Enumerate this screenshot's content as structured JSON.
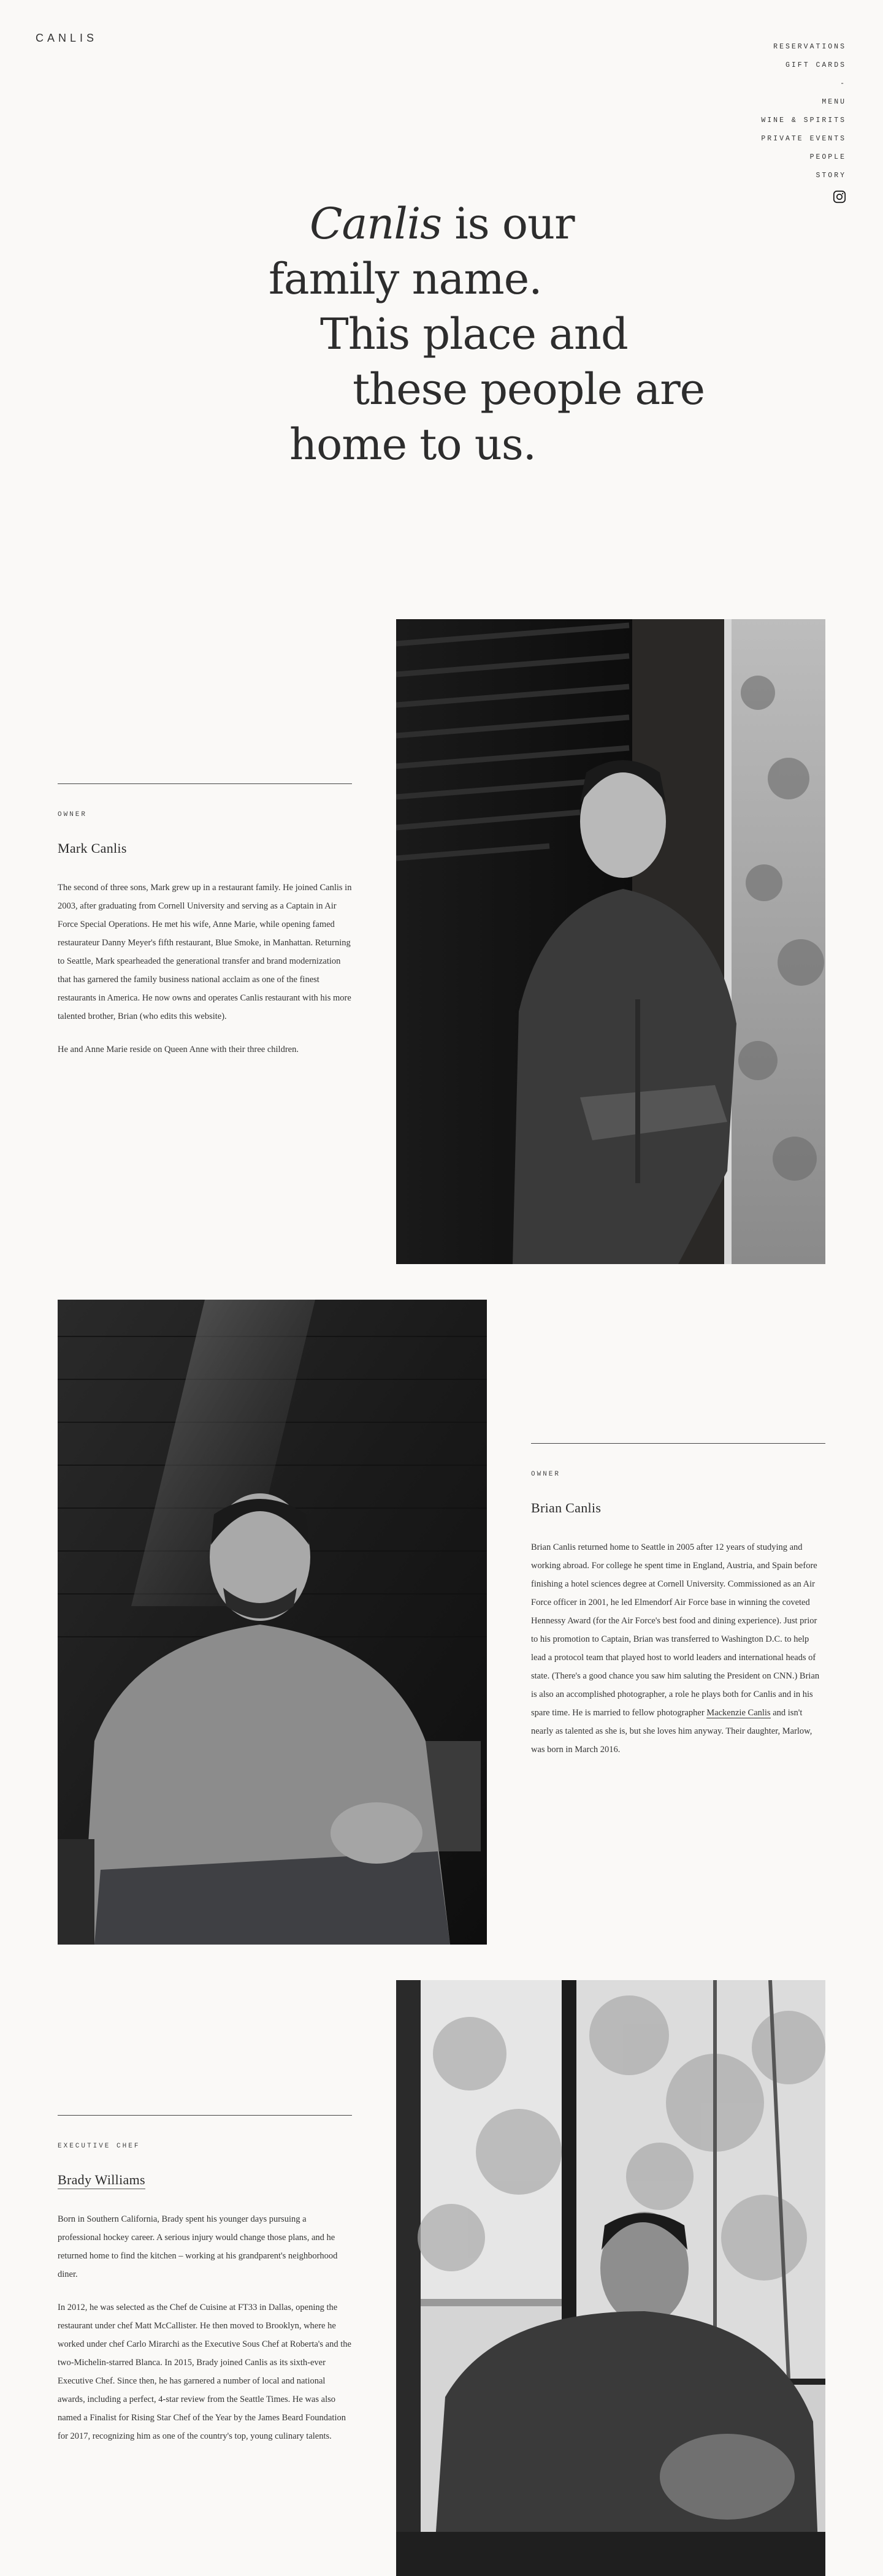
{
  "brand": {
    "logo": "CANLIS"
  },
  "nav": {
    "items": [
      "RESERVATIONS",
      "GIFT CARDS",
      "-",
      "MENU",
      "WINE & SPIRITS",
      "PRIVATE EVENTS",
      "PEOPLE",
      "STORY"
    ],
    "instagram_icon": "instagram-icon"
  },
  "hero": {
    "line1_em": "Canlis",
    "line1_rest": " is our",
    "line2": "family name.",
    "line3": "This place and",
    "line4": "these people are",
    "line5": "home to us."
  },
  "people": [
    {
      "role": "OWNER",
      "name": "Mark Canlis",
      "paragraphs": [
        "The second of three sons, Mark grew up in a restaurant family. He joined Canlis in 2003, after graduating from Cornell University and serving as a Captain in Air Force Special Operations. He met his wife, Anne Marie, while opening famed restaurateur Danny Meyer's fifth restaurant, Blue Smoke, in Manhattan. Returning to Seattle, Mark spearheaded the generational transfer and brand modernization that has garnered the family business national acclaim as one of the finest restaurants in America. He now owns and operates Canlis restaurant with his more talented brother, Brian (who edits this website).",
        "He and Anne Marie reside on Queen Anne with their three children."
      ]
    },
    {
      "role": "OWNER",
      "name": "Brian Canlis",
      "p1_before": "Brian Canlis returned home to Seattle in 2005 after 12 years of studying and working abroad. For college he spent time in England, Austria, and Spain before finishing a hotel sciences degree at Cornell University. Commissioned as an Air Force officer in 2001, he led Elmendorf Air Force base in winning the coveted Hennessy Award (for the Air Force's best food and dining experience). Just prior to his promotion to Captain, Brian was transferred to Washington D.C. to help lead a protocol team that played host to world leaders and international heads of state. (There's a good chance you saw him saluting the President on CNN.) Brian is also an accomplished photographer, a role he plays both for Canlis and in his spare time. He is married to fellow photographer ",
      "p1_link": "Mackenzie Canlis",
      "p1_after": " and isn't nearly as talented as she is, but she loves him anyway. Their daughter, Marlow, was born in March 2016."
    },
    {
      "role": "EXECUTIVE CHEF",
      "name": "Brady Williams",
      "paragraphs": [
        "Born in Southern California, Brady spent his younger days pursuing a professional hockey career. A serious injury would change those plans, and he returned home to find the kitchen – working at his grandparent's neighborhood diner.",
        "In 2012, he was selected as the Chef de Cuisine at FT33 in Dallas, opening the restaurant under chef Matt McCallister. He then moved to Brooklyn, where he worked under chef Carlo Mirarchi as the Executive Sous Chef at Roberta's and the two-Michelin-starred Blanca. In 2015, Brady joined Canlis as its sixth-ever Executive Chef. Since then, he has garnered a number of local and national awards, including a perfect, 4-star review from the Seattle Times. He was also named a Finalist for Rising Star Chef of the Year by the James Beard Foundation for 2017, recognizing him as one of the country's top, young culinary talents."
      ]
    }
  ]
}
